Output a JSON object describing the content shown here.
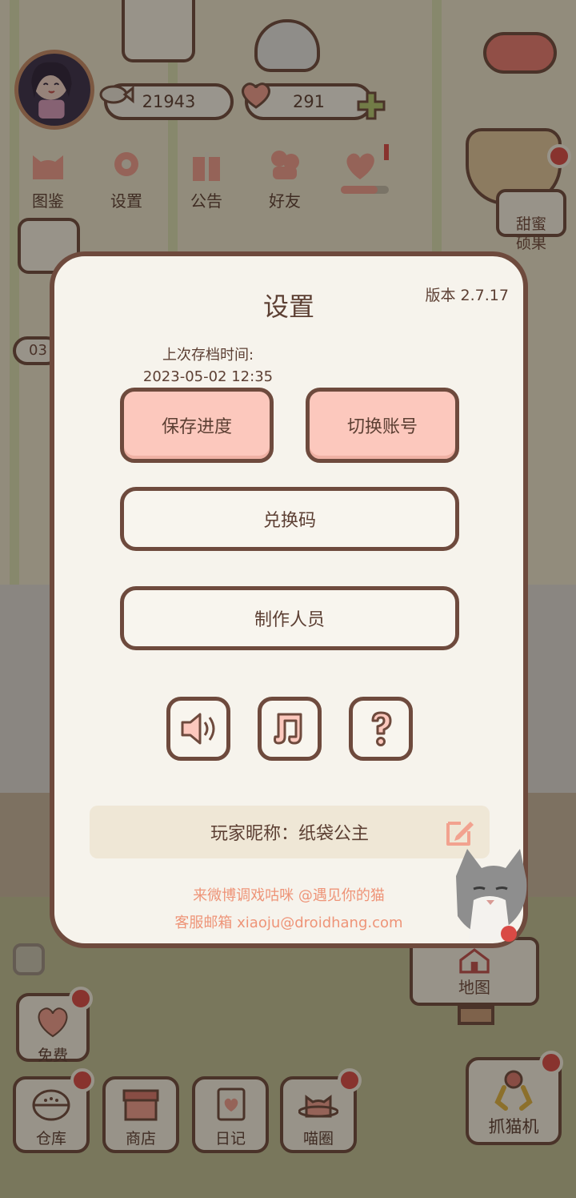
{
  "hud": {
    "coins": "21943",
    "hearts": "291",
    "menu": [
      {
        "label": "图鉴"
      },
      {
        "label": "设置"
      },
      {
        "label": "公告"
      },
      {
        "label": "好友"
      }
    ],
    "sweet_fruit_label": "甜蜜\n硕果",
    "map_label": "地图",
    "free_label": "免费",
    "bottom": [
      {
        "label": "仓库"
      },
      {
        "label": "商店"
      },
      {
        "label": "日记"
      },
      {
        "label": "喵圈"
      }
    ],
    "claw_label": "抓猫机",
    "partial_time": "03"
  },
  "settings": {
    "title": "设置",
    "version": "版本 2.7.17",
    "last_save_label": "上次存档时间:",
    "last_save_time": "2023-05-02 12:35",
    "save_button": "保存进度",
    "switch_account_button": "切换账号",
    "redeem_button": "兑换码",
    "credits_button": "制作人员",
    "icon_buttons": [
      "speaker-icon",
      "music-note-icon",
      "question-mark-icon"
    ],
    "nickname_label": "玩家昵称：",
    "nickname": "纸袋公主",
    "weibo_line": "来微博调戏咕咪 @遇见你的猫",
    "email_line": "客服邮箱 xiaoju@droidhang.com"
  },
  "colors": {
    "accent_pink": "#fcc8bd",
    "outline_brown": "#6e4a3d",
    "panel_bg": "#f6f3ec",
    "link_orange": "#ee9478",
    "badge_red": "#d94a45"
  }
}
